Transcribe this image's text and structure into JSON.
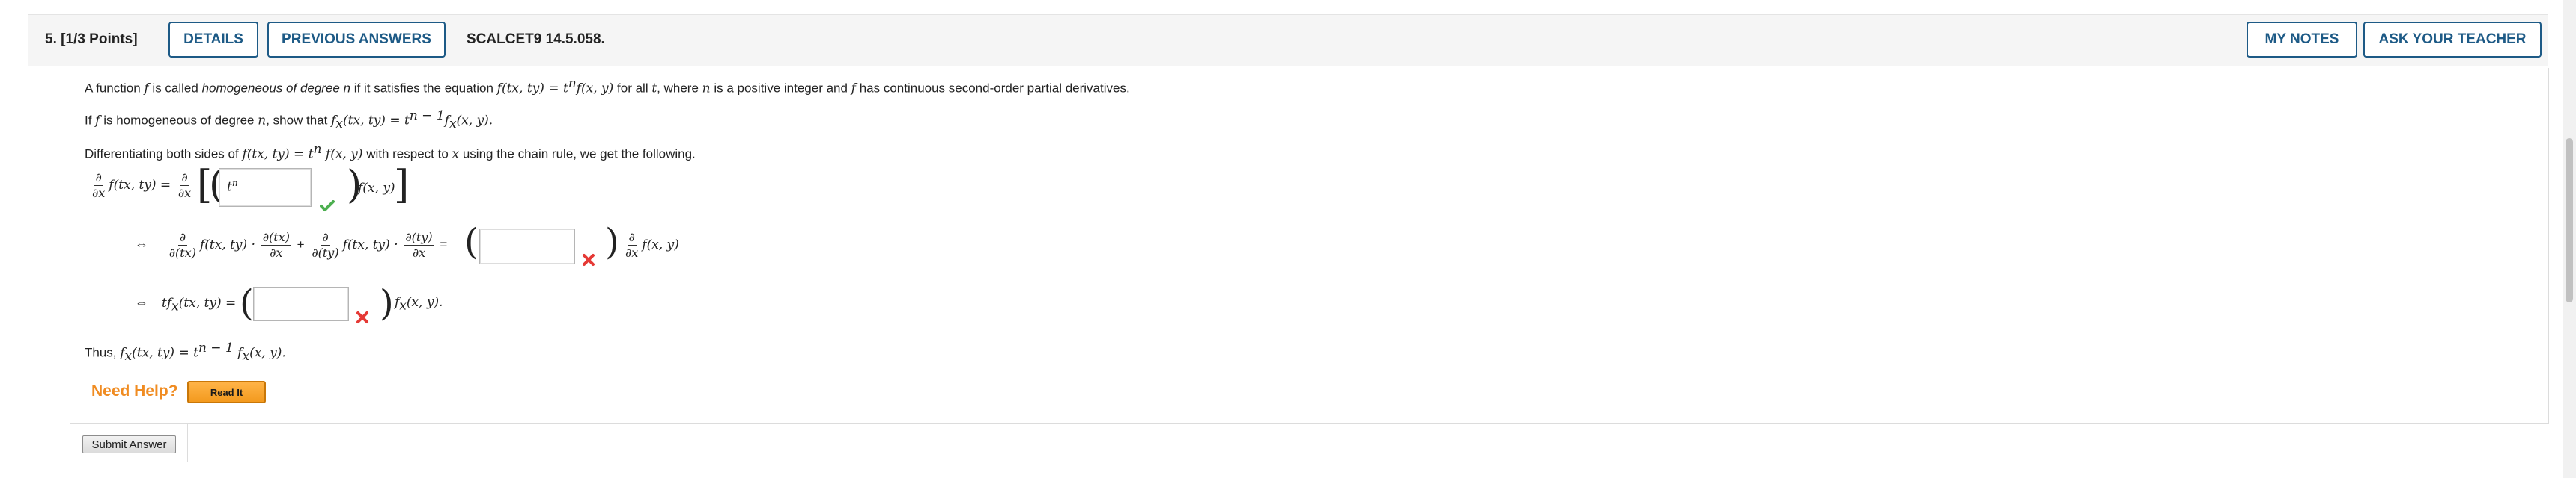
{
  "header": {
    "question_number": "5.",
    "points": "[1/3 Points]",
    "details_label": "DETAILS",
    "previous_answers_label": "PREVIOUS ANSWERS",
    "code": "SCALCET9 14.5.058.",
    "my_notes_label": "MY NOTES",
    "ask_teacher_label": "ASK YOUR TEACHER"
  },
  "problem": {
    "intro_1": "A function ",
    "intro_f": "f",
    "intro_2": " is called ",
    "intro_hom": "homogeneous of degree n",
    "intro_3": " if it satisfies the equation ",
    "intro_eq": "f(tx, ty) = t",
    "intro_eq_sup": "n",
    "intro_eq_2": "f(x, y)",
    "intro_4": " for all ",
    "intro_t": "t",
    "intro_5": ", where ",
    "intro_n": "n",
    "intro_6": " is a positive integer and ",
    "intro_f2": "f",
    "intro_7": " has continuous second-order partial derivatives.",
    "show_1": "If ",
    "show_f": "f",
    "show_2": " is homogeneous of degree ",
    "show_n": "n",
    "show_3": ", show that ",
    "show_eq": "f",
    "show_sub": "x",
    "show_eq_2": "(tx, ty) = t",
    "show_sup": "n − 1",
    "show_eq_3": "f",
    "show_sub_2": "x",
    "show_eq_4": "(x, y).",
    "diff_1": "Differentiating both sides of ",
    "diff_eq": "f(tx, ty) = t",
    "diff_sup": "n",
    "diff_eq_2": " f(x, y)",
    "diff_2": " with respect to ",
    "diff_x": "x",
    "diff_3": " using the chain rule, we get the following."
  },
  "steps": {
    "step1_answer": "t",
    "step1_answer_sup": "n",
    "step1_status": "correct",
    "step2_status": "incorrect",
    "step3_status": "incorrect",
    "partial": "∂",
    "dx": "∂x",
    "f_txty": "f(tx, ty) =",
    "f_xy": "f(x, y)",
    "iff": "⇔",
    "d_tx": "∂(tx)",
    "d_ty": "∂(ty)",
    "f_txty_dot": "f(tx, ty) ·",
    "plus": "+",
    "equals": "=",
    "step3_left": "tf",
    "step3_sub": "x",
    "step3_mid": "(tx, ty) =",
    "step3_right_f": "f",
    "step3_right_sub": "x",
    "step3_right": "(x, y).",
    "thus_1": "Thus, ",
    "thus_eq": "f",
    "thus_sub": "x",
    "thus_eq_2": "(tx, ty) = t",
    "thus_sup": "n − 1",
    "thus_eq_3": " f",
    "thus_sub_2": "x",
    "thus_eq_4": "(x, y)."
  },
  "help": {
    "label": "Need Help?",
    "read_it": "Read It"
  },
  "submit_label": "Submit Answer",
  "colors": {
    "brand_blue": "#1d5a86",
    "correct_green": "#4caf50",
    "incorrect_red": "#e53935",
    "help_orange": "#f08c22"
  }
}
